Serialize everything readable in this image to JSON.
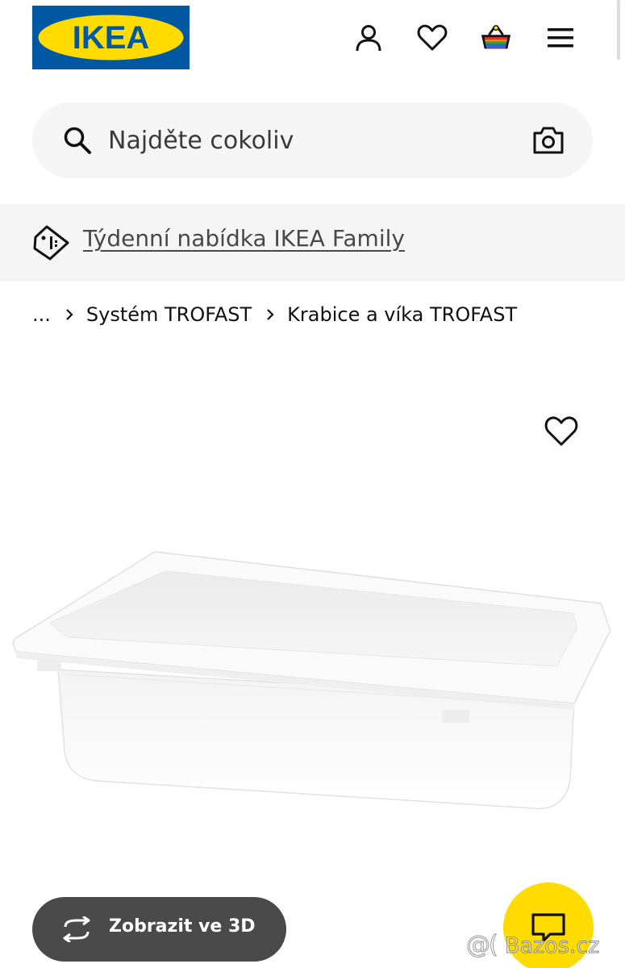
{
  "header": {
    "logo_text": "IKEA",
    "logo_colors": {
      "background": "#0058A3",
      "inner": "#FFDB00"
    },
    "icons": [
      "user-icon",
      "heart-icon",
      "basket-icon",
      "menu-icon"
    ]
  },
  "search": {
    "placeholder": "Najděte cokoliv",
    "value": "",
    "icons": [
      "search-icon",
      "camera-icon"
    ]
  },
  "promo": {
    "label": "Týdenní nabídka IKEA Family",
    "icon": "price-tag-icon"
  },
  "breadcrumb": {
    "items": [
      "...",
      "Systém TROFAST",
      "Krabice a víka TROFAST"
    ]
  },
  "product": {
    "image": "white-storage-box",
    "favorite_icon": "heart-icon"
  },
  "actions": {
    "view_3d_label": "Zobrazit ve 3D",
    "view_3d_icon": "rotate-3d-icon",
    "chat_icon": "chat-icon"
  },
  "watermark": {
    "text": "Bazos.cz"
  },
  "colors": {
    "accent_yellow": "#FFDB00",
    "ikea_blue": "#0058A3",
    "button_dark": "#4A4A4A",
    "panel_gray": "#F5F5F5"
  }
}
